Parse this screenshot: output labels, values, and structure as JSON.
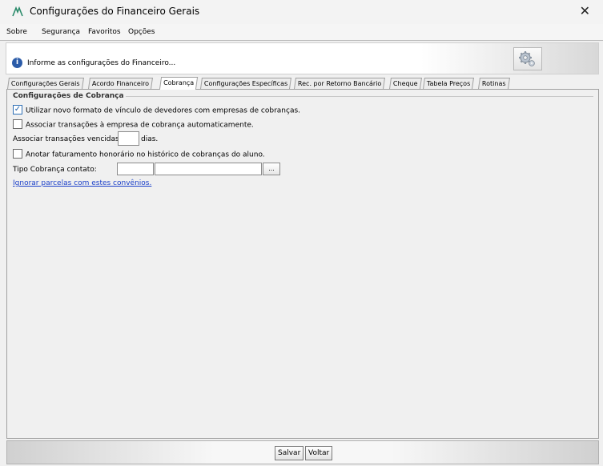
{
  "window": {
    "title": "Configurações do Financeiro Gerais",
    "close_glyph": "✕"
  },
  "menu": {
    "items": [
      "Sobre",
      "Segurança",
      "Favoritos",
      "Opções"
    ]
  },
  "banner": {
    "info_text": "Informe as configurações do Financeiro...",
    "info_icon": "info-icon",
    "settings_icon": "gear-icon"
  },
  "tabs": [
    {
      "label": "Configurações Gerais",
      "active": false
    },
    {
      "label": "Acordo Financeiro",
      "active": false
    },
    {
      "label": "Cobrança",
      "active": true
    },
    {
      "label": "Configurações Específicas",
      "active": false
    },
    {
      "label": "Rec. por Retorno Bancário",
      "active": false
    },
    {
      "label": "Cheque",
      "active": false
    },
    {
      "label": "Tabela Preços",
      "active": false
    },
    {
      "label": "Rotinas",
      "active": false
    }
  ],
  "cobranca": {
    "group_title": "Configurações de Cobrança",
    "opt_novo_formato": {
      "label": "Utilizar novo formato de vínculo de devedores com empresas de cobranças.",
      "checked": true
    },
    "opt_associar_auto": {
      "label": "Associar transações à empresa de cobrança automaticamente.",
      "checked": false
    },
    "vencidas_prefix": "Associar transações vencidas a",
    "vencidas_value": "",
    "vencidas_suffix": "dias.",
    "opt_anotar": {
      "label": "Anotar faturamento honorário no histórico de cobranças do aluno.",
      "checked": false
    },
    "tipo_label": "Tipo Cobrança contato:",
    "tipo_code": "",
    "tipo_desc": "",
    "lookup_label": "...",
    "link_ignorar": "Ignorar parcelas com estes convênios."
  },
  "footer": {
    "save_label": "Salvar",
    "back_label": "Voltar"
  },
  "colors": {
    "accent_link": "#1a3fc9",
    "info_icon": "#2b5ba8",
    "check": "#1d5fa8"
  }
}
